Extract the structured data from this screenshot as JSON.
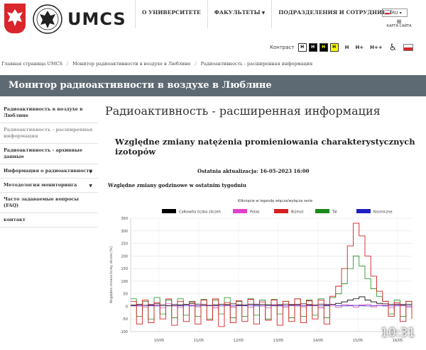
{
  "header": {
    "logo_text": "UMCS",
    "nav": [
      {
        "label": "О УНИВЕРСИТЕТЕ",
        "has_menu": false
      },
      {
        "label": "ФАКУЛЬТЕТЫ",
        "has_menu": true
      },
      {
        "label": "ПОДРАЗДЕЛЕНИЯ И СОТРУДНИКИ",
        "has_menu": false
      }
    ],
    "language": "RU",
    "sitemap_label": "КАРТА САЙТА"
  },
  "toolbar": {
    "contrast_label": "Контраст",
    "contrast_buttons": [
      "H",
      "H",
      "H",
      "H"
    ],
    "font_buttons": [
      "H",
      "H+",
      "H++"
    ]
  },
  "breadcrumb": [
    "Главная страница UMCS",
    "Монитор радиоактивности в воздухе в Люблине",
    "Радиоактивность - расширенная информация"
  ],
  "banner_title": "Монитор радиоактивности в воздухе в Люблине",
  "sidebar": {
    "items": [
      {
        "label": "Радиоактивность в воздухе в Люблине",
        "active": false,
        "has_menu": false
      },
      {
        "label": "Радиоактивность - расширенная информация",
        "active": true,
        "has_menu": false
      },
      {
        "label": "Радиоактивность - архивные данные",
        "active": false,
        "has_menu": false
      },
      {
        "label": "Информация о радиоактивности",
        "active": false,
        "has_menu": true
      },
      {
        "label": "Методология мониторинга",
        "active": false,
        "has_menu": true
      },
      {
        "label": "Часто задаваемые вопросы (FAQ)",
        "active": false,
        "has_menu": false
      },
      {
        "label": "контакт",
        "active": false,
        "has_menu": false
      }
    ]
  },
  "main": {
    "page_title": "Радиоактивность - расширенная информация",
    "section_title": "Względne zmiany natężenia promieniowania charakterystycznych izotopów",
    "updated": "Ostatnia aktualizacja: 16-05-2023 16:00",
    "subtitle": "Względne zmiany godzinowe w ostatnim tygodniu",
    "legend_hint": "Kliknięcie w legendę włącza/wyłącza serie"
  },
  "status": {
    "clock": "10:31"
  },
  "chart_data": {
    "type": "line",
    "ylabel": "Względna zmiana liczby zliczeń [%]",
    "ylim": [
      -100,
      350
    ],
    "yticks": [
      -100,
      -50,
      0,
      50,
      100,
      150,
      200,
      250,
      300,
      350
    ],
    "x": [
      "10/05",
      "11/05",
      "12/05",
      "13/05",
      "14/05",
      "15/05",
      "16/05"
    ],
    "grid": true,
    "legend_placement": "top",
    "series": [
      {
        "name": "Całkowita liczba zliczeń",
        "color": "#000000",
        "values": [
          5,
          8,
          4,
          6,
          10,
          5,
          3,
          7,
          6,
          8,
          12,
          9,
          5,
          4,
          6,
          8,
          7,
          10,
          6,
          5,
          9,
          7,
          8,
          6,
          4,
          7,
          9,
          6,
          8,
          10,
          7,
          5,
          9,
          6,
          8,
          12,
          18,
          25,
          30,
          38,
          25,
          18,
          12,
          10,
          8,
          9,
          7,
          8,
          10
        ]
      },
      {
        "name": "Potas",
        "color": "#e040c8",
        "values": [
          2,
          6,
          -3,
          8,
          4,
          -5,
          10,
          3,
          -4,
          7,
          5,
          -2,
          9,
          4,
          -6,
          8,
          3,
          -3,
          6,
          5,
          -4,
          9,
          2,
          -5,
          7,
          4,
          -3,
          8,
          6,
          -2,
          5,
          3,
          -6,
          9,
          4,
          -4,
          7,
          5,
          -3,
          6,
          8,
          -2,
          5,
          4,
          -5,
          7,
          3,
          -3,
          6
        ]
      },
      {
        "name": "Bizmut",
        "color": "#d42020",
        "values": [
          20,
          -70,
          25,
          -65,
          15,
          -50,
          30,
          -75,
          20,
          -60,
          18,
          -70,
          25,
          -55,
          30,
          -80,
          15,
          -65,
          22,
          -60,
          28,
          -70,
          18,
          -55,
          25,
          -75,
          20,
          -60,
          30,
          -65,
          22,
          -50,
          25,
          -70,
          40,
          80,
          150,
          240,
          330,
          280,
          200,
          120,
          60,
          20,
          -40,
          15,
          -60,
          20,
          -50
        ]
      },
      {
        "name": "Tal",
        "color": "#1a8a1a",
        "values": [
          30,
          -40,
          20,
          -50,
          35,
          -30,
          25,
          -45,
          30,
          -35,
          20,
          -40,
          28,
          -50,
          25,
          -30,
          35,
          -45,
          20,
          -40,
          30,
          -35,
          25,
          -50,
          28,
          -30,
          20,
          -45,
          30,
          -40,
          25,
          -35,
          30,
          -45,
          35,
          50,
          90,
          150,
          200,
          160,
          110,
          70,
          40,
          20,
          -30,
          25,
          -40,
          20,
          -30
        ]
      },
      {
        "name": "Kosmiczne",
        "color": "#2020c0",
        "values": [
          3,
          2,
          4,
          3,
          2,
          4,
          3,
          2,
          3,
          4,
          2,
          3,
          4,
          3,
          2,
          3,
          4,
          2,
          3,
          3,
          4,
          2,
          3,
          4,
          3,
          2,
          3,
          4,
          2,
          3,
          3,
          4,
          2,
          3,
          4,
          3,
          2,
          3,
          4,
          3,
          2,
          3,
          4,
          2,
          3,
          3,
          4,
          2,
          3
        ]
      }
    ]
  }
}
